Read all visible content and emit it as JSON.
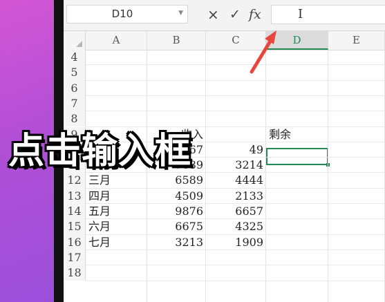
{
  "formula_bar": {
    "name_box": "D10",
    "cancel_symbol": "×",
    "accept_symbol": "✓",
    "fx_label": "fx",
    "cursor_glyph": "I"
  },
  "columns": [
    "A",
    "B",
    "C",
    "D",
    "E"
  ],
  "selected_column": "D",
  "selected_cell": "D10",
  "rows": [
    {
      "num": "4"
    },
    {
      "num": "5"
    },
    {
      "num": "6"
    },
    {
      "num": "7"
    },
    {
      "num": "8"
    },
    {
      "num": "9",
      "b": "收入",
      "d": "剩余"
    },
    {
      "num": "10",
      "b": "67",
      "c": "49"
    },
    {
      "num": "11",
      "a": "二月",
      "b": "7689",
      "c": "3214"
    },
    {
      "num": "12",
      "a": "三月",
      "b": "6589",
      "c": "4444"
    },
    {
      "num": "13",
      "a": "四月",
      "b": "4509",
      "c": "2133"
    },
    {
      "num": "14",
      "a": "五月",
      "b": "9876",
      "c": "6657"
    },
    {
      "num": "15",
      "a": "六月",
      "b": "6675",
      "c": "4325"
    },
    {
      "num": "16",
      "a": "七月",
      "b": "3213",
      "c": "1909"
    },
    {
      "num": "17"
    },
    {
      "num": "18"
    }
  ],
  "overlay_caption": "点击输入框",
  "colors": {
    "accent": "#1f8a52",
    "arrow": "#e8453c"
  }
}
